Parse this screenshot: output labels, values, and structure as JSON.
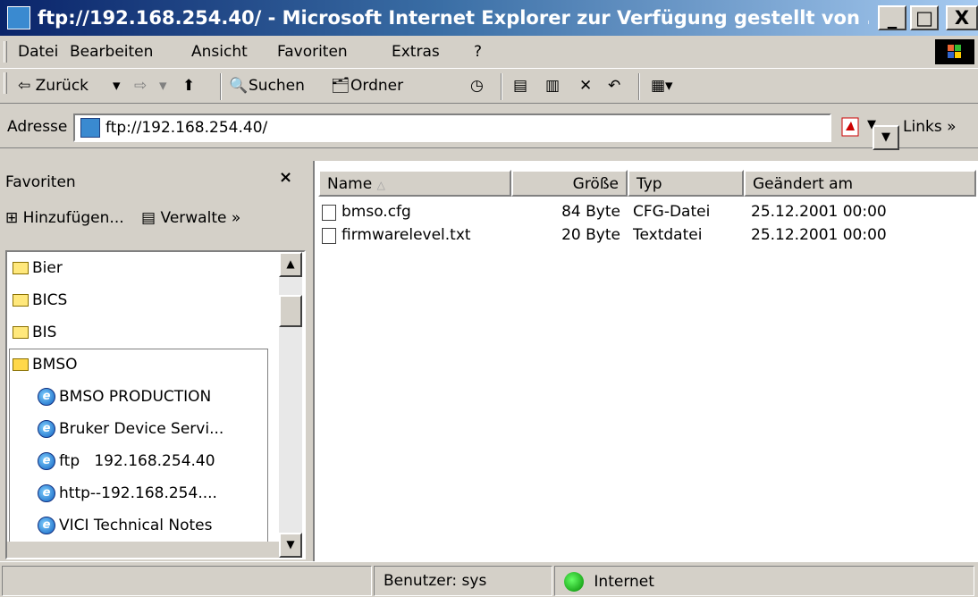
{
  "window": {
    "title": "ftp://192.168.254.40/ - Microsoft Internet Explorer  zur Verfügung gestellt von ...",
    "controls": {
      "minimize": "_",
      "maximize": "□",
      "close": "X"
    }
  },
  "menu": [
    "Datei",
    "Bearbeiten",
    "Ansicht",
    "Favoriten",
    "Extras",
    "?"
  ],
  "toolbar": {
    "back": "⇦ Zurück",
    "back_drop": "▾",
    "forward": "⇨",
    "forward_drop": "▾",
    "up": "⬆",
    "search": "Suchen",
    "folders": "Ordner",
    "view": "▦▾"
  },
  "address": {
    "label": "Adresse",
    "value": "ftp://192.168.254.40/",
    "links": "Links »"
  },
  "favorites": {
    "title": "Favoriten",
    "close": "×",
    "add": "Hinzufügen...",
    "manage": "Verwalte »",
    "items": [
      {
        "label": "Bier",
        "type": "folder"
      },
      {
        "label": "BICS",
        "type": "folder"
      },
      {
        "label": "BIS",
        "type": "folder"
      },
      {
        "label": "BMSO",
        "type": "folder-open"
      },
      {
        "label": "BMSO PRODUCTION",
        "type": "link"
      },
      {
        "label": "Bruker Device Servi...",
        "type": "link"
      },
      {
        "label": "ftp   192.168.254.40",
        "type": "link",
        "selected": true
      },
      {
        "label": "http--192.168.254....",
        "type": "link"
      },
      {
        "label": "VICI Technical Notes",
        "type": "link"
      }
    ]
  },
  "files": {
    "columns": [
      "Name",
      "Größe",
      "Typ",
      "Geändert am"
    ],
    "rows": [
      {
        "name": "bmso.cfg",
        "size": "84 Byte",
        "type": "CFG-Datei",
        "modified": "25.12.2001 00:00"
      },
      {
        "name": "firmwarelevel.txt",
        "size": "20 Byte",
        "type": "Textdatei",
        "modified": "25.12.2001 00:00"
      }
    ]
  },
  "status": {
    "user": "Benutzer: sys",
    "zone": "Internet"
  }
}
